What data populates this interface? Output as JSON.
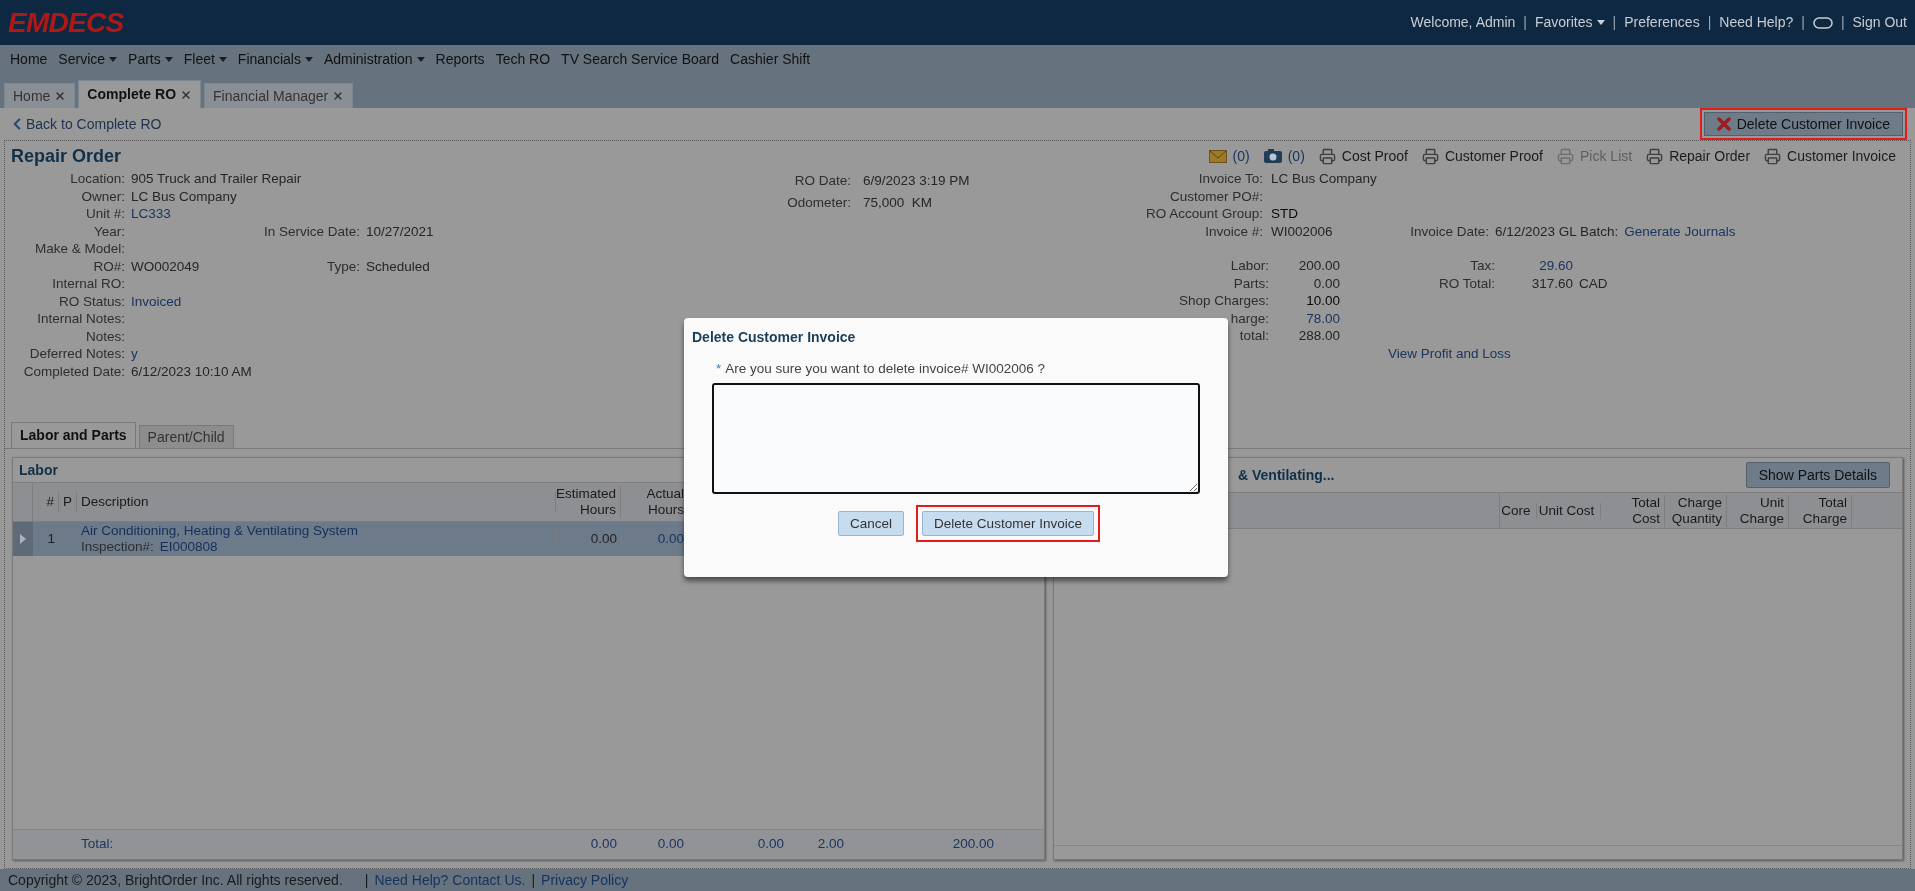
{
  "header": {
    "logo": "EMDECS",
    "separator": "|",
    "links": [
      {
        "kind": "text",
        "text": "Welcome, Admin"
      },
      {
        "kind": "menu",
        "text": "Favorites"
      },
      {
        "kind": "text",
        "text": "Preferences"
      },
      {
        "kind": "text",
        "text": "Need Help?"
      },
      {
        "kind": "icon"
      },
      {
        "kind": "text",
        "text": "Sign Out"
      }
    ]
  },
  "nav": [
    {
      "label": "Home",
      "dropdown": false
    },
    {
      "label": "Service",
      "dropdown": true
    },
    {
      "label": "Parts",
      "dropdown": true
    },
    {
      "label": "Fleet",
      "dropdown": true
    },
    {
      "label": "Financials",
      "dropdown": true
    },
    {
      "label": "Administration",
      "dropdown": true
    },
    {
      "label": "Reports",
      "dropdown": false
    },
    {
      "label": "Tech RO",
      "dropdown": false
    },
    {
      "label": "TV Search Service Board",
      "dropdown": false
    },
    {
      "label": "Cashier Shift",
      "dropdown": false
    }
  ],
  "tabs": [
    {
      "label": "Home",
      "selected": false
    },
    {
      "label": "Complete RO",
      "selected": true
    },
    {
      "label": "Financial Manager",
      "selected": false
    }
  ],
  "back_link": "Back to Complete RO",
  "delete_button": {
    "label": "Delete Customer Invoice",
    "highlighted": true
  },
  "repair_order": {
    "title": "Repair Order",
    "toolbar": [
      {
        "kind": "email",
        "label": "(0)",
        "disabled": false
      },
      {
        "kind": "camera",
        "label": "(0)",
        "disabled": false
      },
      {
        "kind": "print",
        "label": "Cost Proof",
        "disabled": false
      },
      {
        "kind": "print",
        "label": "Customer Proof",
        "disabled": false
      },
      {
        "kind": "print",
        "label": "Pick List",
        "disabled": true
      },
      {
        "kind": "print",
        "label": "Repair Order",
        "disabled": false
      },
      {
        "kind": "print",
        "label": "Customer Invoice",
        "disabled": false
      }
    ],
    "left_fields": [
      {
        "label": "Location:",
        "value": "905 Truck and Trailer Repair",
        "kind": "plain"
      },
      {
        "label": "Owner:",
        "value": "LC Bus Company",
        "kind": "plain"
      },
      {
        "label": "Unit #:",
        "value": "LC333",
        "kind": "link"
      },
      {
        "label": "Year:",
        "extra_label": "In Service Date:",
        "extra_value": "10/27/2021"
      },
      {
        "label": "Make & Model:"
      },
      {
        "label": "RO#:",
        "value": "WO002049",
        "kind": "plain",
        "extra_label": "Type:",
        "extra_value": "Scheduled"
      },
      {
        "label": "Internal RO:"
      },
      {
        "label": "RO Status:",
        "value": "Invoiced",
        "kind": "link"
      },
      {
        "label": "Internal Notes:"
      },
      {
        "label": "Notes:"
      },
      {
        "label": "Deferred Notes:",
        "value": "y",
        "kind": "link"
      },
      {
        "label": "Completed Date:",
        "value": "6/12/2023 10:10 AM",
        "kind": "plain"
      }
    ],
    "middle_fields": [
      {
        "label": "RO Date:",
        "value": "6/9/2023 3:19 PM",
        "kind": "plain"
      },
      {
        "label": "Odometer:",
        "value": "75,000  KM",
        "kind": "plain"
      }
    ],
    "invoice_fields": [
      {
        "label": "Invoice To:",
        "value": "LC Bus Company",
        "kind": "plain"
      },
      {
        "label": "Customer PO#:"
      },
      {
        "label": "RO Account Group:",
        "value": "STD",
        "kind": "strong"
      },
      {
        "label": "Invoice #:",
        "value": "WI002006",
        "kind": "plain",
        "extra_label": "Invoice Date:",
        "extra_value": "6/12/2023 GL Batch:",
        "extra_link": "Generate Journals"
      }
    ],
    "totals": [
      {
        "label": "Labor:",
        "value": "200.00",
        "kind": "plain",
        "extra_label": "Tax:",
        "extra_value": "29.60",
        "extra_link": true
      },
      {
        "label": "Parts:",
        "value": "0.00",
        "kind": "plain",
        "extra_label": "RO Total:",
        "extra_value": "317.60",
        "extra_link": false,
        "currency": "CAD"
      },
      {
        "label": "Shop Charges:",
        "value": "10.00",
        "kind": "strong"
      },
      {
        "label": "harge:",
        "value": "78.00",
        "kind": "link"
      },
      {
        "label": "total:",
        "value": "288.00",
        "kind": "plain"
      }
    ],
    "profit_link": "View Profit and Loss"
  },
  "section_tabs": [
    {
      "label": "Labor and Parts",
      "selected": true
    },
    {
      "label": "Parent/Child",
      "selected": false
    }
  ],
  "labor": {
    "title": "Labor",
    "columns": [
      "#",
      "P",
      "Description",
      "Estimated Hours",
      "Actual Hours"
    ],
    "rows": [
      {
        "number": "1",
        "description": "Air Conditioning, Heating & Ventilating System",
        "inspection_label": "Inspection#:",
        "inspection_value": "EI000808",
        "estimated": "0.00",
        "actual": "0.00",
        "selected": true
      }
    ],
    "total_label": "Total:",
    "totals": [
      "0.00",
      "0.00",
      "0.00",
      "2.00",
      "200.00"
    ]
  },
  "parts": {
    "title": "& Ventilating...",
    "button": "Show Parts Details",
    "columns": [
      "Core",
      "Unit Cost",
      "Total Cost",
      "Charge Quantity",
      "Unit Charge",
      "Total Charge"
    ]
  },
  "dialog": {
    "title": "Delete Customer Invoice",
    "prompt": "Are you sure you want to delete invoice# WI002006 ?",
    "required_mark": "*",
    "buttons": [
      {
        "label": "Cancel",
        "highlighted": false
      },
      {
        "label": "Delete Customer Invoice",
        "highlighted": true
      }
    ]
  },
  "footer": {
    "separator": "|",
    "copyright": "Copyright © 2023, BrightOrder Inc. All rights reserved.",
    "links": [
      "Need Help? Contact Us.",
      "Privacy Policy"
    ]
  }
}
